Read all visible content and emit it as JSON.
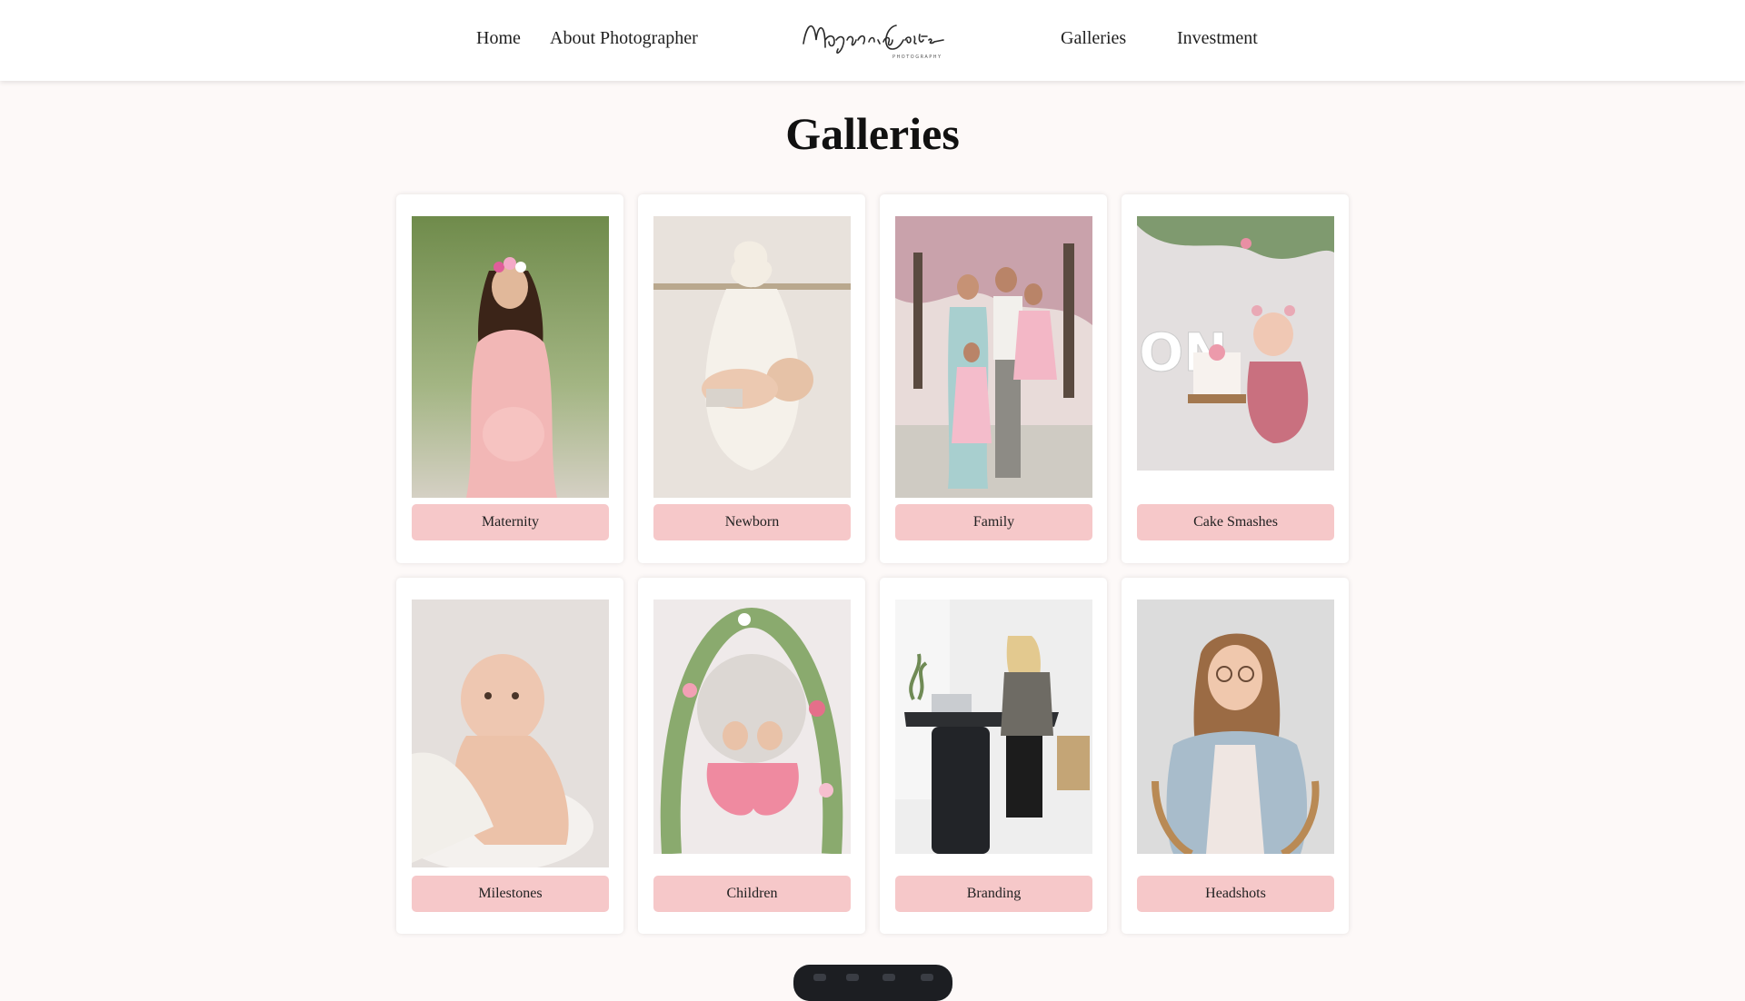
{
  "nav": {
    "home": "Home",
    "about": "About Photographer",
    "galleries": "Galleries",
    "investment": "Investment"
  },
  "logo": {
    "script_text": "Magnolia Coasts",
    "sub_text": "PHOTOGRAPHY"
  },
  "page": {
    "title": "Galleries"
  },
  "galleries": [
    {
      "label": "Maternity",
      "image": "maternity-photo"
    },
    {
      "label": "Newborn",
      "image": "newborn-photo"
    },
    {
      "label": "Family",
      "image": "family-photo"
    },
    {
      "label": "Cake Smashes",
      "image": "cake-smash-photo"
    },
    {
      "label": "Milestones",
      "image": "milestones-photo"
    },
    {
      "label": "Children",
      "image": "children-photo"
    },
    {
      "label": "Branding",
      "image": "branding-photo"
    },
    {
      "label": "Headshots",
      "image": "headshots-photo"
    }
  ],
  "colors": {
    "page_background": "#fdf9f8",
    "button": "#f6c8c9",
    "card": "#ffffff"
  }
}
